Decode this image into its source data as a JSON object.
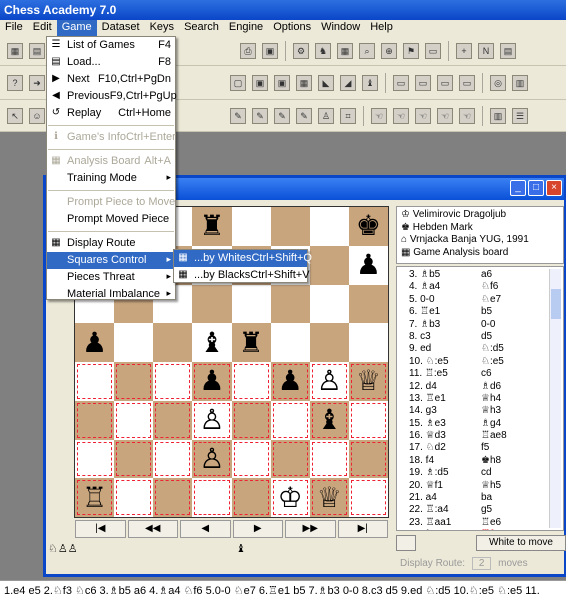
{
  "app": {
    "title": "Chess Academy 7.0"
  },
  "menubar": [
    "File",
    "Edit",
    "Game",
    "Dataset",
    "Keys",
    "Search",
    "Engine",
    "Options",
    "Window",
    "Help"
  ],
  "game_menu": [
    {
      "label": "List of Games",
      "shortcut": "F4",
      "icon": "list-icon",
      "state": "normal"
    },
    {
      "label": "Load...",
      "shortcut": "F8",
      "icon": "load-icon",
      "state": "normal"
    },
    {
      "label": "Next",
      "shortcut": "F10,Ctrl+PgDn",
      "icon": "next-icon",
      "state": "normal"
    },
    {
      "label": "Previous",
      "shortcut": "F9,Ctrl+PgUp",
      "icon": "previous-icon",
      "state": "normal"
    },
    {
      "label": "Replay",
      "shortcut": "Ctrl+Home",
      "icon": "replay-icon",
      "state": "normal"
    },
    {
      "sep": true
    },
    {
      "label": "Game's Info",
      "shortcut": "Ctrl+Enter",
      "icon": "info-icon",
      "state": "disabled"
    },
    {
      "sep": true
    },
    {
      "label": "Analysis Board",
      "shortcut": "Alt+A",
      "icon": "analysis-icon",
      "state": "disabled"
    },
    {
      "label": "Training Mode",
      "shortcut": "",
      "icon": "",
      "state": "submenu"
    },
    {
      "sep": true
    },
    {
      "label": "Prompt Piece to Move",
      "shortcut": "",
      "icon": "",
      "state": "disabled"
    },
    {
      "label": "Prompt Moved Piece",
      "shortcut": "",
      "icon": "",
      "state": "normal"
    },
    {
      "sep": true
    },
    {
      "label": "Display Route",
      "shortcut": "",
      "icon": "route-icon",
      "state": "normal"
    },
    {
      "label": "Squares Control",
      "shortcut": "",
      "icon": "",
      "state": "highlighted-submenu"
    },
    {
      "label": "Pieces Threat",
      "shortcut": "",
      "icon": "",
      "state": "submenu"
    },
    {
      "label": "Material Imbalance",
      "shortcut": "",
      "icon": "",
      "state": "submenu"
    }
  ],
  "squares_submenu": [
    {
      "label": "...by Whites",
      "shortcut": "Ctrl+Shift+Q",
      "state": "highlighted"
    },
    {
      "label": "...by Blacks",
      "shortcut": "Ctrl+Shift+V",
      "state": "normal"
    }
  ],
  "game_info": {
    "white": "Velimirovic Dragoljub",
    "black": "Hebden Mark",
    "event": "Vrnjacka Banja YUG, 1991",
    "board": "Game Analysis board"
  },
  "moves": [
    {
      "w": "3. ♗b5",
      "b": "a6"
    },
    {
      "w": "4. ♗a4",
      "b": "♘f6"
    },
    {
      "w": "5. 0-0",
      "b": "♘e7"
    },
    {
      "w": "6. ♖e1",
      "b": "b5"
    },
    {
      "w": "7. ♗b3",
      "b": "0-0"
    },
    {
      "w": "8. c3",
      "b": "d5"
    },
    {
      "w": "9. ed",
      "b": "♘:d5"
    },
    {
      "w": "10. ♘:e5",
      "b": "♘:e5"
    },
    {
      "w": "11. ♖:e5",
      "b": "c6"
    },
    {
      "w": "12. d4",
      "b": "♗d6"
    },
    {
      "w": "13. ♖e1",
      "b": "♕h4"
    },
    {
      "w": "14. g3",
      "b": "♕h3"
    },
    {
      "w": "15. ♗e3",
      "b": "♗g4"
    },
    {
      "w": "16. ♕d3",
      "b": "♖ae8"
    },
    {
      "w": "17. ♘d2",
      "b": "f5"
    },
    {
      "w": "18. f4",
      "b": "♚h8"
    },
    {
      "w": "19. ♗:d5",
      "b": "cd"
    },
    {
      "w": "20. ♕f1",
      "b": "♕h5"
    },
    {
      "w": "21. a4",
      "b": "ba"
    },
    {
      "w": "22. ♖:a4",
      "b": "g5"
    },
    {
      "w": "23. ♖aa1",
      "b": "♖e6"
    },
    {
      "w": "24. fg",
      "b": "♖fe8",
      "hl": true
    }
  ],
  "board": [
    [
      "",
      "",
      "",
      "r",
      "",
      "",
      "",
      "k"
    ],
    [
      "",
      "",
      "",
      "",
      "",
      "",
      "",
      "p"
    ],
    [
      "",
      "",
      "",
      "",
      "",
      "",
      "",
      ""
    ],
    [
      "p",
      "",
      "",
      "b",
      "r",
      "",
      "",
      ""
    ],
    [
      "",
      "",
      "",
      "p",
      "",
      "p",
      "P",
      "Q"
    ],
    [
      "",
      "",
      "",
      "P",
      "",
      "",
      "b",
      ""
    ],
    [
      "",
      "",
      "",
      "P",
      "",
      "",
      "",
      ""
    ],
    [
      "R",
      "",
      "",
      "",
      "",
      "K",
      "Q",
      ""
    ]
  ],
  "controls": {
    "white_to_move": "White to move",
    "display_route": "Display Route:",
    "route_value": "2",
    "moves_label": "moves"
  },
  "bottom_notation": "1.e4 e5 2.♘f3 ♘c6 3.♗b5 a6 4.♗a4 ♘f6 5.0-0 ♘e7 6.♖e1 b5 7.♗b3 0-0 8.c3 d5 9.ed ♘:d5 10.♘:e5 ♘:e5 11."
}
